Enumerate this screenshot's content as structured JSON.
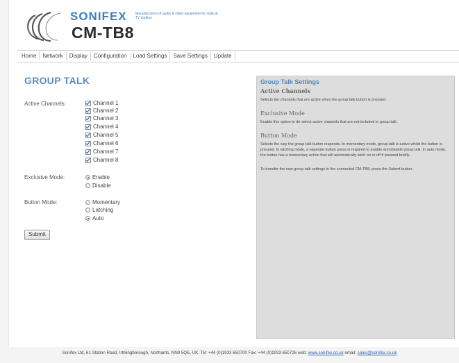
{
  "header": {
    "brand": "SONIFEX",
    "tagline": "Manufacturers of audio & video equipment for radio & TV studios",
    "product": "CM-TB8"
  },
  "nav": {
    "items": [
      "Home",
      "Network",
      "Display",
      "Configuration",
      "Load Settings",
      "Save Settings",
      "Update"
    ]
  },
  "main": {
    "title": "GROUP TALK",
    "active_channels_label": "Active Channels:",
    "channels": [
      "Channel 1",
      "Channel 2",
      "Channel 3",
      "Channel 4",
      "Channel 5",
      "Channel 6",
      "Channel 7",
      "Channel 8"
    ],
    "exclusive_mode_label": "Exclusive Mode:",
    "exclusive_options": [
      "Enable",
      "Disable"
    ],
    "exclusive_selected": "Enable",
    "button_mode_label": "Button Mode:",
    "button_options": [
      "Momentary",
      "Latching",
      "Auto"
    ],
    "button_selected": "Auto",
    "submit_label": "Submit"
  },
  "panel": {
    "title": "Group Talk Settings",
    "active_heading": "Active Channels",
    "active_text": "Selects the channels that are active when the group talk button is pressed.",
    "exclusive_heading": "Exclusive Mode",
    "exclusive_text": "Enable this option to de-select active channels that are not included in group talk.",
    "button_heading": "Button Mode",
    "button_text": "Selects the way the group talk button responds. In momentary mode, group talk is active whilst the button is pressed. In latching mode, a seperate button press is required to enable and disable group talk. In auto mode, the button has a momentary action that will automatically latch on or off if pressed briefly.",
    "note_text": "To transfer the new group talk settings to the connected CM-TB8, press the Submit button."
  },
  "footer": {
    "text": "Sonifex Ltd, 61 Station Road, Irthlingborough, Northants, NN9 5QE, UK. Tel: +44 (0)1933 650700 Fax: +44 (0)1933 650726 web:",
    "web_link": "www.sonifex.co.uk",
    "email_label": "email:",
    "email_link": "sales@sonifex.co.uk"
  },
  "colors": {
    "accent": "#4f86bd",
    "title": "#5a8ec0",
    "panel_bg": "#dddddd"
  }
}
